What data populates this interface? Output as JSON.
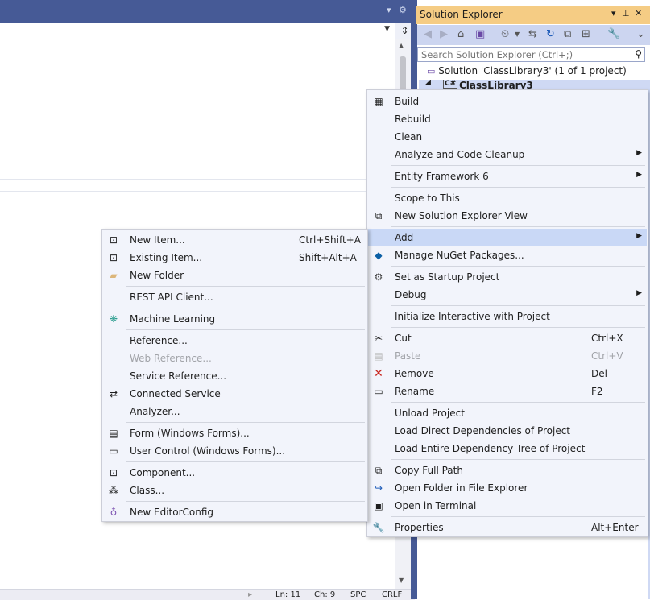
{
  "solution_explorer": {
    "title": "Solution Explorer",
    "search_placeholder": "Search Solution Explorer (Ctrl+;)",
    "solution_label": "Solution 'ClassLibrary3' (1 of 1 project)",
    "project_label": "ClassLibrary3"
  },
  "status_bar": {
    "line": "Ln: 11",
    "col": "Ch: 9",
    "spc": "SPC",
    "eol": "CRLF"
  },
  "context_menu": {
    "items": [
      {
        "label": "Build",
        "icon": "build-icon"
      },
      {
        "label": "Rebuild"
      },
      {
        "label": "Clean"
      },
      {
        "label": "Analyze and Code Cleanup",
        "submenu": true
      },
      {
        "label": "Entity Framework 6",
        "submenu": true
      },
      {
        "label": "Scope to This"
      },
      {
        "label": "New Solution Explorer View",
        "icon": "new-view-icon"
      },
      {
        "label": "Add",
        "submenu": true,
        "highlighted": true
      },
      {
        "label": "Manage NuGet Packages...",
        "icon": "nuget-icon"
      },
      {
        "label": "Set as Startup Project",
        "icon": "gear-icon"
      },
      {
        "label": "Debug",
        "submenu": true
      },
      {
        "label": "Initialize Interactive with Project"
      },
      {
        "label": "Cut",
        "shortcut": "Ctrl+X",
        "icon": "scissors-icon"
      },
      {
        "label": "Paste",
        "shortcut": "Ctrl+V",
        "icon": "paste-icon",
        "disabled": true
      },
      {
        "label": "Remove",
        "shortcut": "Del",
        "icon": "remove-icon"
      },
      {
        "label": "Rename",
        "shortcut": "F2",
        "icon": "rename-icon"
      },
      {
        "label": "Unload Project"
      },
      {
        "label": "Load Direct Dependencies of Project"
      },
      {
        "label": "Load Entire Dependency Tree of Project"
      },
      {
        "label": "Copy Full Path",
        "icon": "copy-icon"
      },
      {
        "label": "Open Folder in File Explorer",
        "icon": "open-folder-icon"
      },
      {
        "label": "Open in Terminal",
        "icon": "terminal-icon"
      },
      {
        "label": "Properties",
        "shortcut": "Alt+Enter",
        "icon": "wrench-icon"
      }
    ]
  },
  "add_submenu": {
    "items": [
      {
        "label": "New Item...",
        "shortcut": "Ctrl+Shift+A",
        "icon": "new-item-icon"
      },
      {
        "label": "Existing Item...",
        "shortcut": "Shift+Alt+A",
        "icon": "existing-item-icon"
      },
      {
        "label": "New Folder",
        "icon": "folder-icon"
      },
      {
        "label": "REST API Client..."
      },
      {
        "label": "Machine Learning",
        "icon": "ml-icon"
      },
      {
        "label": "Reference..."
      },
      {
        "label": "Web Reference...",
        "disabled": true
      },
      {
        "label": "Service Reference..."
      },
      {
        "label": "Connected Service",
        "icon": "connected-service-icon"
      },
      {
        "label": "Analyzer..."
      },
      {
        "label": "Form (Windows Forms)...",
        "icon": "form-icon"
      },
      {
        "label": "User Control (Windows Forms)...",
        "icon": "user-control-icon"
      },
      {
        "label": "Component...",
        "icon": "component-icon"
      },
      {
        "label": "Class...",
        "icon": "class-icon"
      },
      {
        "label": "New EditorConfig",
        "icon": "lightbulb-icon"
      }
    ]
  },
  "colors": {
    "accent": "#465a96",
    "title_active": "#f5cc84",
    "menu_bg": "#f2f4fb",
    "highlight": "#c9d8f6"
  }
}
